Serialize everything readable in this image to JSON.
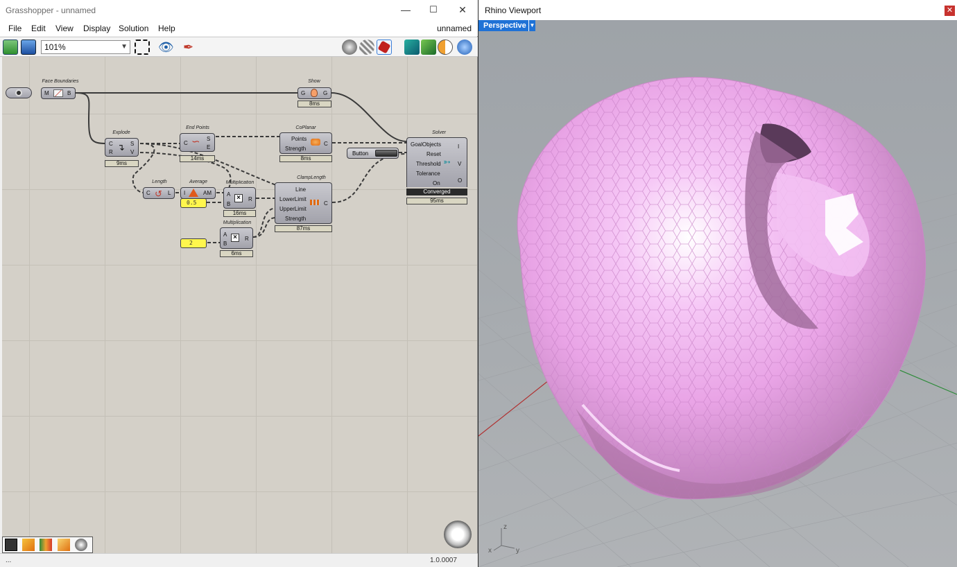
{
  "grasshopper": {
    "title": "Grasshopper - unnamed",
    "doc_name": "unnamed",
    "menu": [
      "File",
      "Edit",
      "View",
      "Display",
      "Solution",
      "Help"
    ],
    "zoom": "101%",
    "version": "1.0.0007",
    "status_left": "...",
    "components": {
      "face_boundaries": {
        "name": "Face Boundaries",
        "in": "M",
        "out": "B"
      },
      "show": {
        "name": "Show",
        "in": "G",
        "out": "G",
        "timer": "8ms"
      },
      "explode": {
        "name": "Explode",
        "in1": "C",
        "in2": "R",
        "out1": "S",
        "out2": "V",
        "timer": "9ms"
      },
      "end_points": {
        "name": "End Points",
        "in": "C",
        "out1": "S",
        "out2": "E",
        "timer": "14ms"
      },
      "coplanar": {
        "name": "CoPlanar",
        "in1": "Points",
        "in2": "Strength",
        "out": "C",
        "timer": "8ms"
      },
      "button": {
        "label": "Button"
      },
      "solver": {
        "name": "Solver",
        "inputs": [
          "GoalObjects",
          "Reset",
          "Threshold",
          "Tolerance",
          "On"
        ],
        "outputs": [
          "I",
          "V",
          "O"
        ],
        "state": "Converged",
        "timer": "95ms"
      },
      "length": {
        "name": "Length",
        "in": "C",
        "out": "L"
      },
      "average": {
        "name": "Average",
        "in": "I",
        "out": "AM"
      },
      "slider1": {
        "value": "0.5"
      },
      "multiplication1": {
        "name": "Multiplication",
        "in1": "A",
        "in2": "B",
        "out": "R",
        "timer": "16ms"
      },
      "clamp_length": {
        "name": "ClampLength",
        "inputs": [
          "Line",
          "LowerLimit",
          "UpperLimit",
          "Strength"
        ],
        "out": "C",
        "timer": "87ms"
      },
      "multiplication2": {
        "name": "Multiplication",
        "in1": "A",
        "in2": "B",
        "out": "R",
        "timer": "6ms"
      },
      "slider2": {
        "value": "2"
      }
    }
  },
  "rhino": {
    "title": "Rhino Viewport",
    "view_name": "Perspective",
    "axes": {
      "z": "z",
      "x": "x",
      "y": "y"
    },
    "mesh_color": "#f0b2f0",
    "x_axis_color": "#b03030",
    "y_axis_color": "#2e8b3a"
  }
}
